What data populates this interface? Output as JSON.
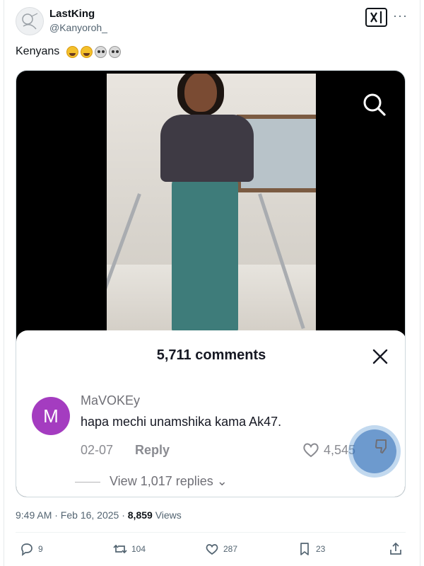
{
  "tweet": {
    "author_name": "LastKing",
    "author_handle": "@Kanyoroh_",
    "text": "Kenyans",
    "emojis": [
      "face-with-tears-of-joy",
      "face-with-tears-of-joy",
      "skull",
      "skull"
    ],
    "timestamp": "9:49 AM · Feb 16, 2025 · ",
    "views_count": "8,859",
    "views_label": " Views"
  },
  "media": {
    "comments_title": "5,711 comments",
    "comment": {
      "avatar_letter": "M",
      "username": "MaVOKEy",
      "text": "hapa mechi unamshika kama Ak47.",
      "date": "02-07",
      "reply_label": "Reply",
      "likes": "4,545",
      "view_replies": "View 1,017 replies ⌄"
    }
  },
  "actions": {
    "replies": "9",
    "retweets": "104",
    "likes": "287",
    "bookmarks": "23"
  },
  "colors": {
    "comment_avatar": "#a43cc0",
    "touch_indicator": "#3c78be"
  }
}
